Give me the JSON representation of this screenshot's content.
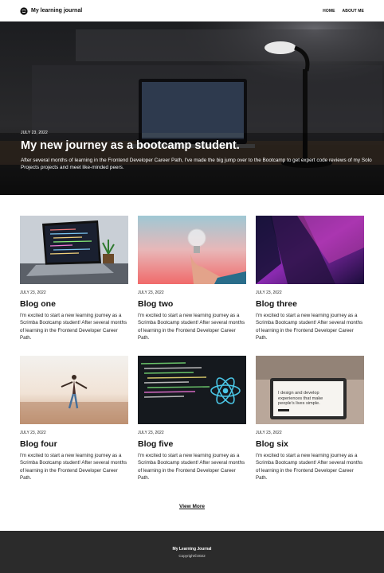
{
  "header": {
    "title": "My learning journal",
    "nav": [
      "HOME",
      "ABOUT ME"
    ]
  },
  "hero": {
    "date": "JULY 23, 2022",
    "title": "My new journey as a bootcamp student.",
    "description": "After several months of learning in the Frontend Developer Career Path, I've made the big jump over to the Bootcamp to get expert code reviews of my Solo Projects projects and meet like-minded peers."
  },
  "posts": [
    {
      "date": "JULY 23, 2022",
      "title": "Blog one",
      "body": "I'm excited to start a new learning journey as a Scrimba Bootcamp student! After several months of learning in the Frontend Developer Career Path."
    },
    {
      "date": "JULY 23, 2022",
      "title": "Blog two",
      "body": "I'm excited to start a new learning journey as a Scrimba Bootcamp student! After several months of learning in the Frontend Developer Career Path."
    },
    {
      "date": "JULY 23, 2022",
      "title": "Blog three",
      "body": "I'm excited to start a new learning journey as a Scrimba Bootcamp student! After several months of learning in the Frontend Developer Career Path."
    },
    {
      "date": "JULY 23, 2022",
      "title": "Blog four",
      "body": "I'm excited to start a new learning journey as a Scrimba Bootcamp student! After several months of learning in the Frontend Developer Career Path."
    },
    {
      "date": "JULY 23, 2022",
      "title": "Blog five",
      "body": "I'm excited to start a new learning journey as a Scrimba Bootcamp student! After several months of learning in the Frontend Developer Career Path."
    },
    {
      "date": "JULY 23, 2022",
      "title": "Blog six",
      "body": "I'm excited to start a new learning journey as a Scrimba Bootcamp student! After several months of learning in the Frontend Developer Career Path."
    }
  ],
  "view_more": "View More",
  "thumb6_text": "I design and develop experiences that make people's lives simple.",
  "footer": {
    "title": "My Learning Journal",
    "copyright": "Copyright©2022"
  }
}
